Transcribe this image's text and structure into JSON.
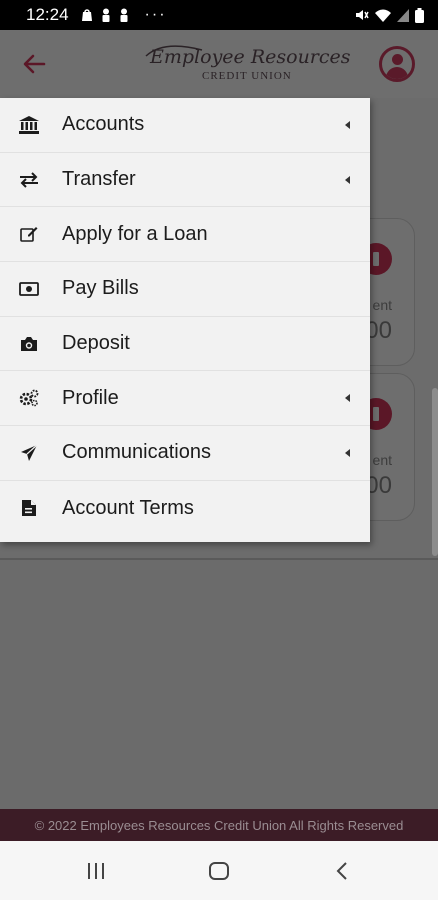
{
  "status_bar": {
    "time": "12:24",
    "overflow": "···"
  },
  "header": {
    "logo_script": "Employee Resources",
    "logo_sub": "CREDIT UNION"
  },
  "background_cards": [
    {
      "label": "ent",
      "amount": "00"
    },
    {
      "label": "ent",
      "amount": "00"
    }
  ],
  "menu": {
    "items": [
      {
        "label": "Accounts",
        "icon": "bank-icon",
        "has_submenu": true
      },
      {
        "label": "Transfer",
        "icon": "transfer-arrows-icon",
        "has_submenu": true
      },
      {
        "label": "Apply for a Loan",
        "icon": "edit-icon",
        "has_submenu": false
      },
      {
        "label": "Pay Bills",
        "icon": "money-bill-icon",
        "has_submenu": false
      },
      {
        "label": "Deposit",
        "icon": "camera-icon",
        "has_submenu": false
      },
      {
        "label": "Profile",
        "icon": "gears-icon",
        "has_submenu": true
      },
      {
        "label": "Communications",
        "icon": "paper-plane-icon",
        "has_submenu": true
      },
      {
        "label": "Account Terms",
        "icon": "document-icon",
        "has_submenu": false
      }
    ]
  },
  "footer": {
    "text": "© 2022 Employees Resources Credit Union All Rights Reserved"
  },
  "colors": {
    "brand": "#5b1727",
    "overlay": "#6b6b6b",
    "menu_bg": "#f2f2f2",
    "footer_bg": "#3c1c26"
  }
}
